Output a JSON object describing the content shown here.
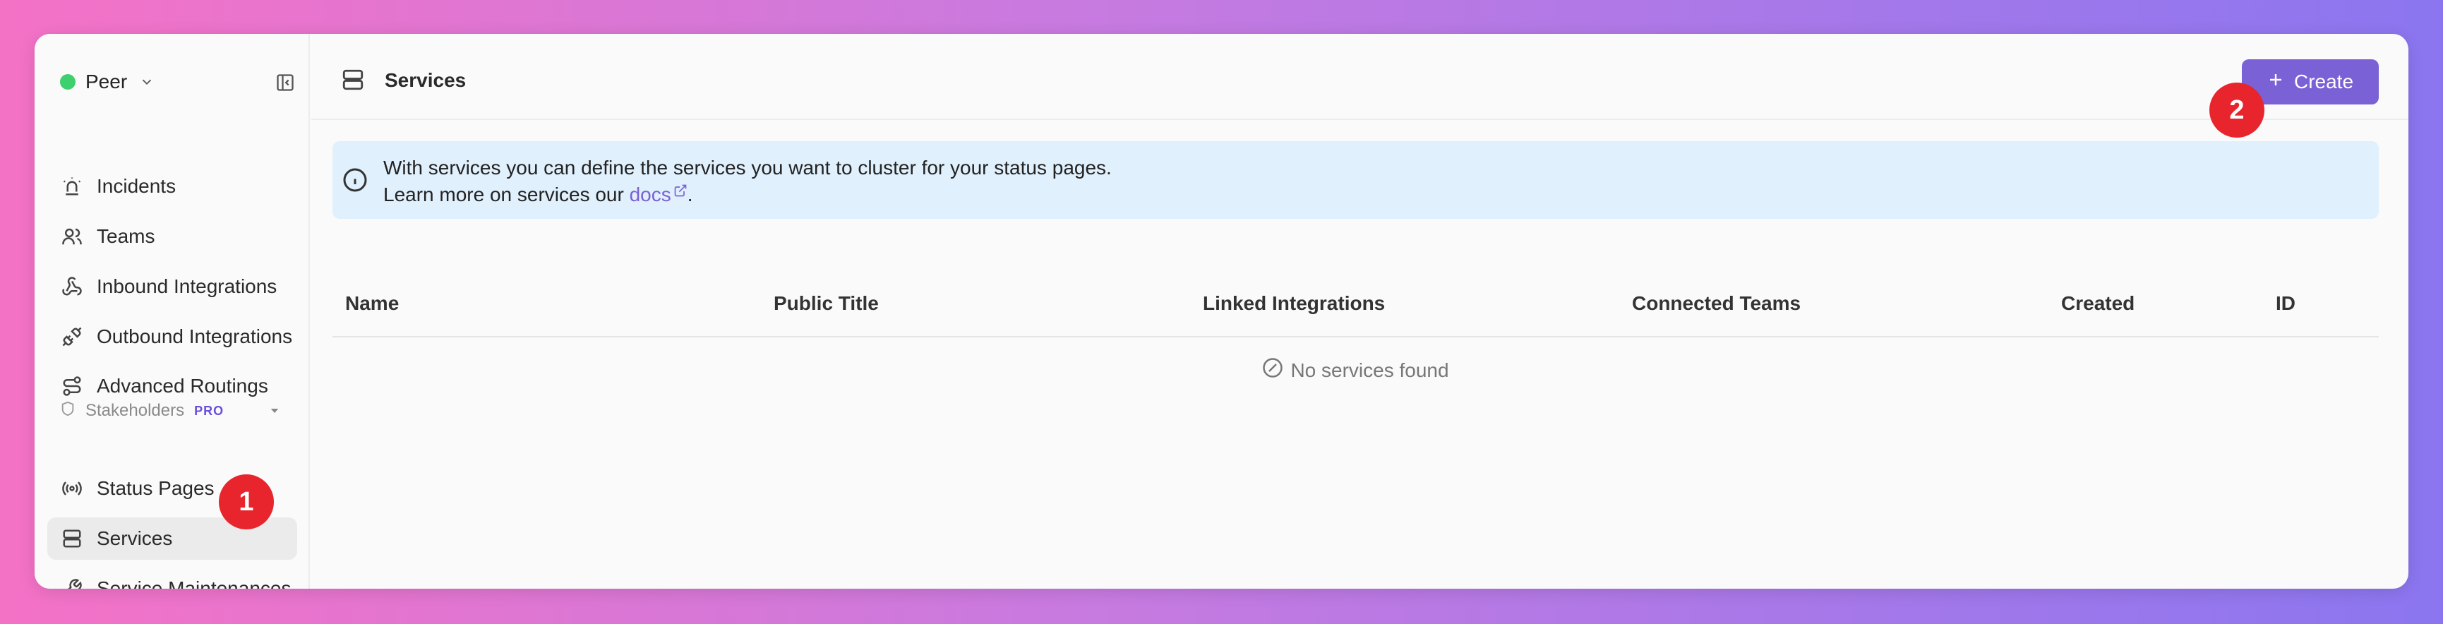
{
  "workspace": {
    "name": "Peer",
    "status_color": "#3ecf6e"
  },
  "sidebar": {
    "items": [
      {
        "label": "Incidents",
        "icon": "siren-icon"
      },
      {
        "label": "Teams",
        "icon": "users-icon"
      },
      {
        "label": "Inbound Integrations",
        "icon": "webhook-icon"
      },
      {
        "label": "Outbound Integrations",
        "icon": "plug-icon"
      },
      {
        "label": "Advanced Routings",
        "icon": "route-icon"
      }
    ],
    "section": {
      "label": "Stakeholders",
      "badge": "PRO"
    },
    "section_items": [
      {
        "label": "Status Pages",
        "icon": "broadcast-icon"
      },
      {
        "label": "Services",
        "icon": "server-icon",
        "active": true
      },
      {
        "label": "Service Maintenances",
        "icon": "wrench-icon"
      }
    ]
  },
  "header": {
    "title": "Services",
    "create_label": "Create"
  },
  "info": {
    "line1": "With services you can define the services you want to cluster for your status pages.",
    "line2_prefix": "Learn more on services our ",
    "link": "docs",
    "line2_suffix": "."
  },
  "table": {
    "columns": [
      "Name",
      "Public Title",
      "Linked Integrations",
      "Connected Teams",
      "Created",
      "ID"
    ],
    "empty_text": "No services found"
  },
  "markers": [
    "1",
    "2"
  ],
  "colors": {
    "accent": "#7b61d6",
    "marker": "#e8252c",
    "info_bg": "#e0f0fd"
  }
}
